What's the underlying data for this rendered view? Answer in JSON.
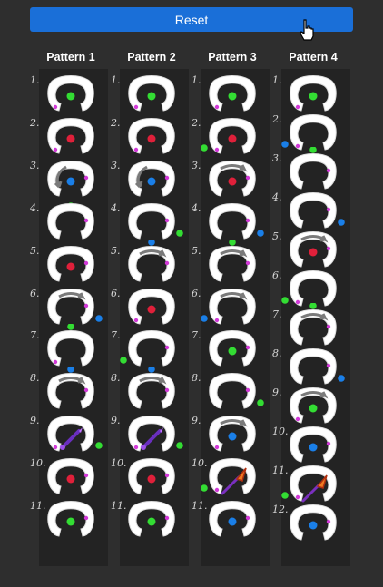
{
  "reset_label": "Reset",
  "colors": {
    "background": "#2e2e2e",
    "button": "#1a6fd8",
    "green": "#33dd33",
    "red": "#e0203a",
    "blue": "#1a7fe8",
    "magenta": "#d23ad8",
    "ring": "#ffffff"
  },
  "patterns": [
    {
      "title": "Pattern 1",
      "steps": [
        {
          "label": "1.",
          "center": "green",
          "pink": "left",
          "outside": null,
          "arrow": null,
          "icon": null
        },
        {
          "label": "2.",
          "center": "red",
          "pink": "left",
          "outside": null,
          "arrow": null,
          "icon": null
        },
        {
          "label": "3.",
          "center": "blue",
          "pink": "right",
          "outside": "bottom-green",
          "arrow": "left",
          "icon": null
        },
        {
          "label": "4.",
          "center": null,
          "pink": "right",
          "outside": null,
          "arrow": null,
          "icon": null
        },
        {
          "label": "5.",
          "center": "red",
          "pink": "right",
          "outside": null,
          "arrow": null,
          "icon": null
        },
        {
          "label": "6.",
          "center": null,
          "pink": "right",
          "outside": "right-blue",
          "arrow": "top",
          "icon": null
        },
        {
          "label": "7.",
          "center": null,
          "pink": "left",
          "outside": "top-green",
          "arrow": null,
          "icon": null
        },
        {
          "label": "8.",
          "center": null,
          "pink": "right",
          "outside": "top-blue",
          "arrow": "top",
          "icon": null
        },
        {
          "label": "9.",
          "center": null,
          "pink": "left",
          "outside": "right-green",
          "arrow": null,
          "icon": "wand"
        },
        {
          "label": "10.",
          "center": "red",
          "pink": "right",
          "outside": null,
          "arrow": null,
          "icon": null
        },
        {
          "label": "11.",
          "center": "green",
          "pink": "right",
          "outside": null,
          "arrow": null,
          "icon": null
        }
      ]
    },
    {
      "title": "Pattern 2",
      "steps": [
        {
          "label": "1.",
          "center": "green",
          "pink": "left",
          "outside": null,
          "arrow": null,
          "icon": null
        },
        {
          "label": "2.",
          "center": "red",
          "pink": "left",
          "outside": null,
          "arrow": null,
          "icon": null
        },
        {
          "label": "3.",
          "center": "blue",
          "pink": "right",
          "outside": null,
          "arrow": "left",
          "icon": null
        },
        {
          "label": "4.",
          "center": null,
          "pink": "right",
          "outside": "right-green",
          "arrow": null,
          "icon": null
        },
        {
          "label": "5.",
          "center": null,
          "pink": "right",
          "outside": "top-blue",
          "arrow": "top",
          "icon": null
        },
        {
          "label": "6.",
          "center": "red",
          "pink": "left",
          "outside": null,
          "arrow": null,
          "icon": null
        },
        {
          "label": "7.",
          "center": null,
          "pink": "right",
          "outside": "left-green",
          "arrow": null,
          "icon": null
        },
        {
          "label": "8.",
          "center": null,
          "pink": "right",
          "outside": "top-blue",
          "arrow": "top",
          "icon": null
        },
        {
          "label": "9.",
          "center": null,
          "pink": "left",
          "outside": "right-green",
          "arrow": null,
          "icon": "wand"
        },
        {
          "label": "10.",
          "center": "red",
          "pink": "right",
          "outside": null,
          "arrow": null,
          "icon": null
        },
        {
          "label": "11.",
          "center": "green",
          "pink": "right",
          "outside": null,
          "arrow": null,
          "icon": null
        }
      ]
    },
    {
      "title": "Pattern 3",
      "steps": [
        {
          "label": "1.",
          "center": "green",
          "pink": "left",
          "outside": null,
          "arrow": null,
          "icon": null
        },
        {
          "label": "2.",
          "center": "red",
          "pink": "left",
          "outside": "left-green",
          "arrow": null,
          "icon": null
        },
        {
          "label": "3.",
          "center": "red",
          "pink": "right",
          "outside": null,
          "arrow": "top",
          "icon": null
        },
        {
          "label": "4.",
          "center": null,
          "pink": "right",
          "outside": "right-blue",
          "arrow": null,
          "icon": null
        },
        {
          "label": "5.",
          "center": null,
          "pink": "right",
          "outside": "top-green",
          "arrow": "top",
          "icon": null
        },
        {
          "label": "6.",
          "center": null,
          "pink": "left",
          "outside": "left-blue",
          "arrow": "top",
          "icon": null
        },
        {
          "label": "7.",
          "center": "green",
          "pink": "right",
          "outside": null,
          "arrow": null,
          "icon": null
        },
        {
          "label": "8.",
          "center": null,
          "pink": "right",
          "outside": "right-green",
          "arrow": null,
          "icon": null
        },
        {
          "label": "9.",
          "center": "blue",
          "pink": "left",
          "outside": null,
          "arrow": "top",
          "icon": null
        },
        {
          "label": "10.",
          "center": null,
          "pink": "left",
          "outside": "left-green",
          "arrow": null,
          "icon": "spear"
        },
        {
          "label": "11.",
          "center": "blue",
          "pink": "right",
          "outside": null,
          "arrow": null,
          "icon": null
        }
      ]
    },
    {
      "title": "Pattern 4",
      "steps": [
        {
          "label": "1.",
          "center": "green",
          "pink": "left",
          "outside": null,
          "arrow": null,
          "icon": null
        },
        {
          "label": "2.",
          "center": null,
          "pink": "left",
          "outside": "left-blue",
          "arrow": null,
          "icon": null
        },
        {
          "label": "3.",
          "center": null,
          "pink": "right",
          "outside": "top-green",
          "arrow": null,
          "icon": null
        },
        {
          "label": "4.",
          "center": null,
          "pink": "right",
          "outside": "right-blue",
          "arrow": null,
          "icon": null
        },
        {
          "label": "5.",
          "center": "red",
          "pink": "right",
          "outside": null,
          "arrow": "top",
          "icon": null
        },
        {
          "label": "6.",
          "center": null,
          "pink": "left",
          "outside": "left-green",
          "arrow": null,
          "icon": null
        },
        {
          "label": "7.",
          "center": null,
          "pink": "right",
          "outside": "top-green",
          "arrow": "top",
          "icon": null
        },
        {
          "label": "8.",
          "center": null,
          "pink": "right",
          "outside": "right-blue",
          "arrow": null,
          "icon": null
        },
        {
          "label": "9.",
          "center": "green",
          "pink": "left",
          "outside": null,
          "arrow": "top",
          "icon": null
        },
        {
          "label": "10.",
          "center": "blue",
          "pink": "right",
          "outside": null,
          "arrow": null,
          "icon": null
        },
        {
          "label": "11.",
          "center": null,
          "pink": "left",
          "outside": "left-green",
          "arrow": null,
          "icon": "spear"
        },
        {
          "label": "12.",
          "center": "blue",
          "pink": "right",
          "outside": null,
          "arrow": null,
          "icon": null
        }
      ]
    }
  ]
}
